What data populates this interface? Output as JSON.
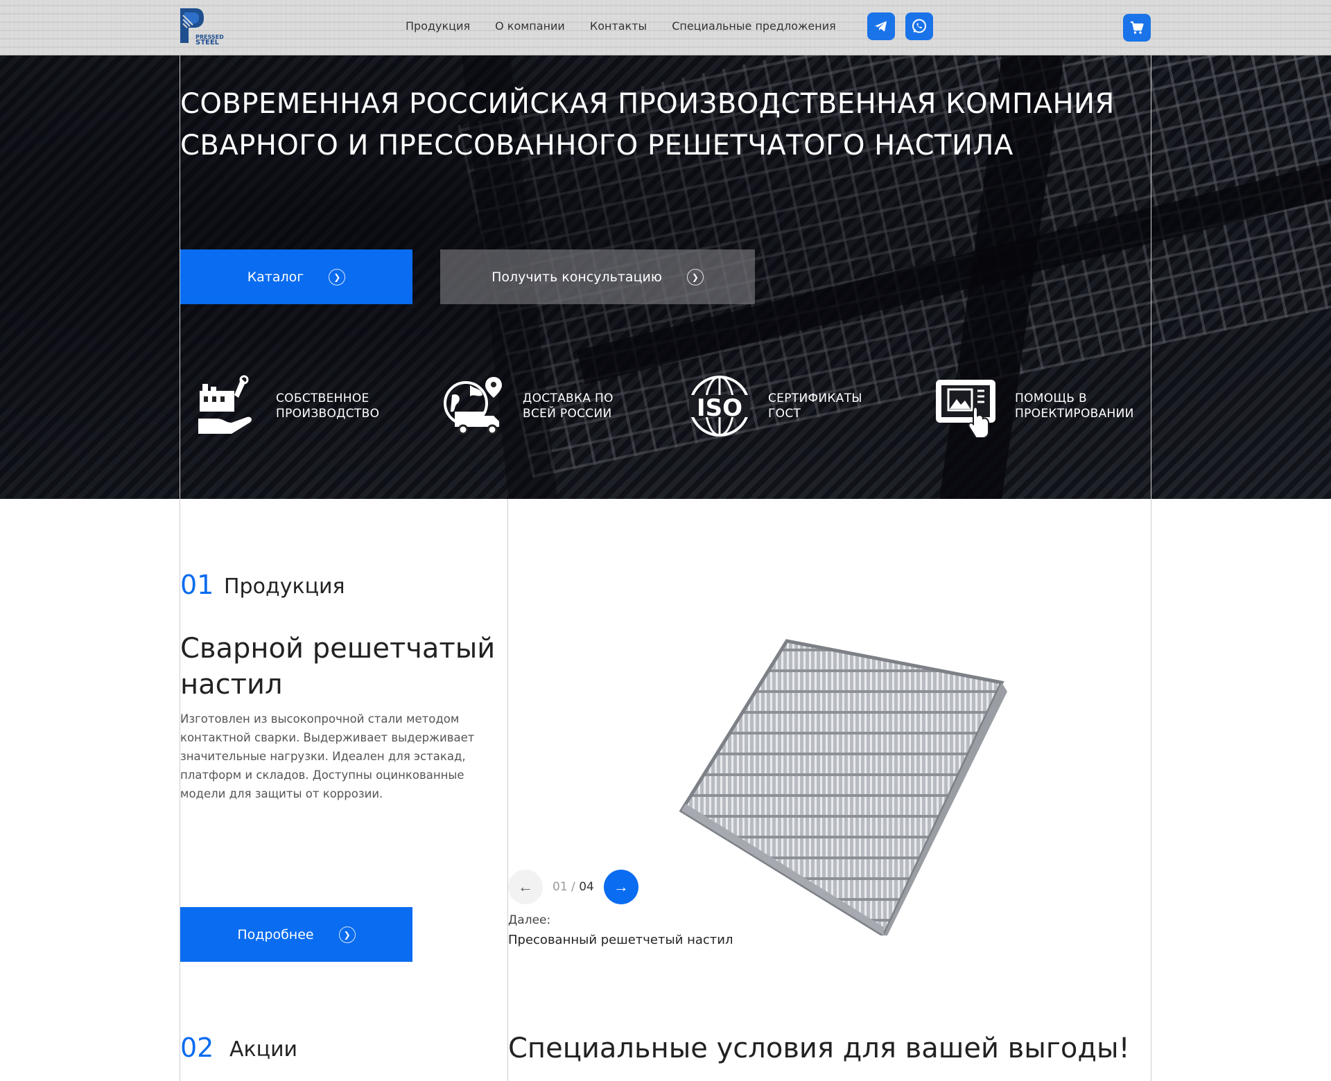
{
  "header": {
    "logo_text_line1": "PRESSED",
    "logo_text_line2": "STEEL",
    "nav": [
      {
        "label": "Продукция"
      },
      {
        "label": "О компании"
      },
      {
        "label": "Контакты"
      },
      {
        "label": "Специальные предложения"
      }
    ],
    "icons": [
      "telegram-icon",
      "whatsapp-icon",
      "cart-icon"
    ],
    "accent_color": "#1a73e8"
  },
  "hero": {
    "title_line1": "СОВРЕМЕННАЯ РОССИЙСКАЯ ПРОИЗВОДСТВЕННАЯ КОМПАНИЯ",
    "title_line2": "СВАРНОГО И ПРЕССОВАННОГО РЕШЕТЧАТОГО НАСТИЛА",
    "catalog_button": "Каталог",
    "consult_button": "Получить консультацию",
    "features": [
      {
        "icon": "factory-icon",
        "line1": "СОБСТВЕННОЕ",
        "line2": "ПРОИЗВОДСТВО"
      },
      {
        "icon": "delivery-icon",
        "line1": "ДОСТАВКА ПО",
        "line2": "ВСЕЙ РОССИИ"
      },
      {
        "icon": "iso-icon",
        "line1": "СЕРТИФИКАТЫ",
        "line2": "ГОСТ"
      },
      {
        "icon": "design-help-icon",
        "line1": "ПОМОЩЬ В",
        "line2": "ПРОЕКТИРОВАНИИ"
      }
    ]
  },
  "products": {
    "number": "01",
    "label": "Продукция",
    "title": "Сварной решетчатый настил",
    "description": "Изготовлен из высокопрочной стали методом контактной сварки. Выдерживает  выдерживает значительные нагрузки. Идеален для эстакад, платформ и складов. Доступны оцинкованные модели для защиты от коррозии.",
    "more_button": "Подробнее",
    "pager_current": "01",
    "pager_separator": " / ",
    "pager_total": "04",
    "next_label": "Далее:",
    "next_name": "Пресованный решетчетый настил"
  },
  "promo": {
    "number": "02",
    "label": "Акции",
    "title": "Специальные условия для вашей выгоды!"
  },
  "colors": {
    "blue": "#0a6cf0",
    "dark": "#15171d"
  }
}
